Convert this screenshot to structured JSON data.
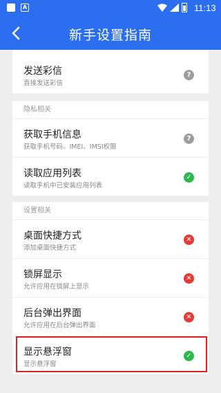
{
  "status_bar": {
    "time": "11:13",
    "notif_icon": "A"
  },
  "app_bar": {
    "title": "新手设置指南",
    "back_icon": "arrow-left"
  },
  "sections": [
    {
      "header": "",
      "items": [
        {
          "title": "发送彩信",
          "subtitle": "直接发送彩信",
          "status": "unknown",
          "icon": "?"
        }
      ]
    },
    {
      "header": "隐私相关",
      "items": [
        {
          "title": "获取手机信息",
          "subtitle": "获取手机号码、IMEI、IMSI权限",
          "status": "unknown",
          "icon": "?"
        },
        {
          "title": "读取应用列表",
          "subtitle": "读取手机中已安装应用列表",
          "status": "granted",
          "icon": "✓"
        }
      ]
    },
    {
      "header": "设置相关",
      "items": [
        {
          "title": "桌面快捷方式",
          "subtitle": "添加桌面快捷方式",
          "status": "denied",
          "icon": "✕"
        },
        {
          "title": "锁屏显示",
          "subtitle": "允许应用在锁屏上显示",
          "status": "denied",
          "icon": "✕"
        },
        {
          "title": "后台弹出界面",
          "subtitle": "允许应用在后台弹出界面",
          "status": "denied",
          "icon": "✕"
        },
        {
          "title": "显示悬浮窗",
          "subtitle": "显示悬浮窗",
          "status": "granted",
          "icon": "✓"
        }
      ]
    }
  ],
  "colors": {
    "primary": "#2b6ff0",
    "granted": "#2db84d",
    "denied": "#e53935",
    "unknown": "#9e9e9e",
    "highlight": "#e02020"
  }
}
